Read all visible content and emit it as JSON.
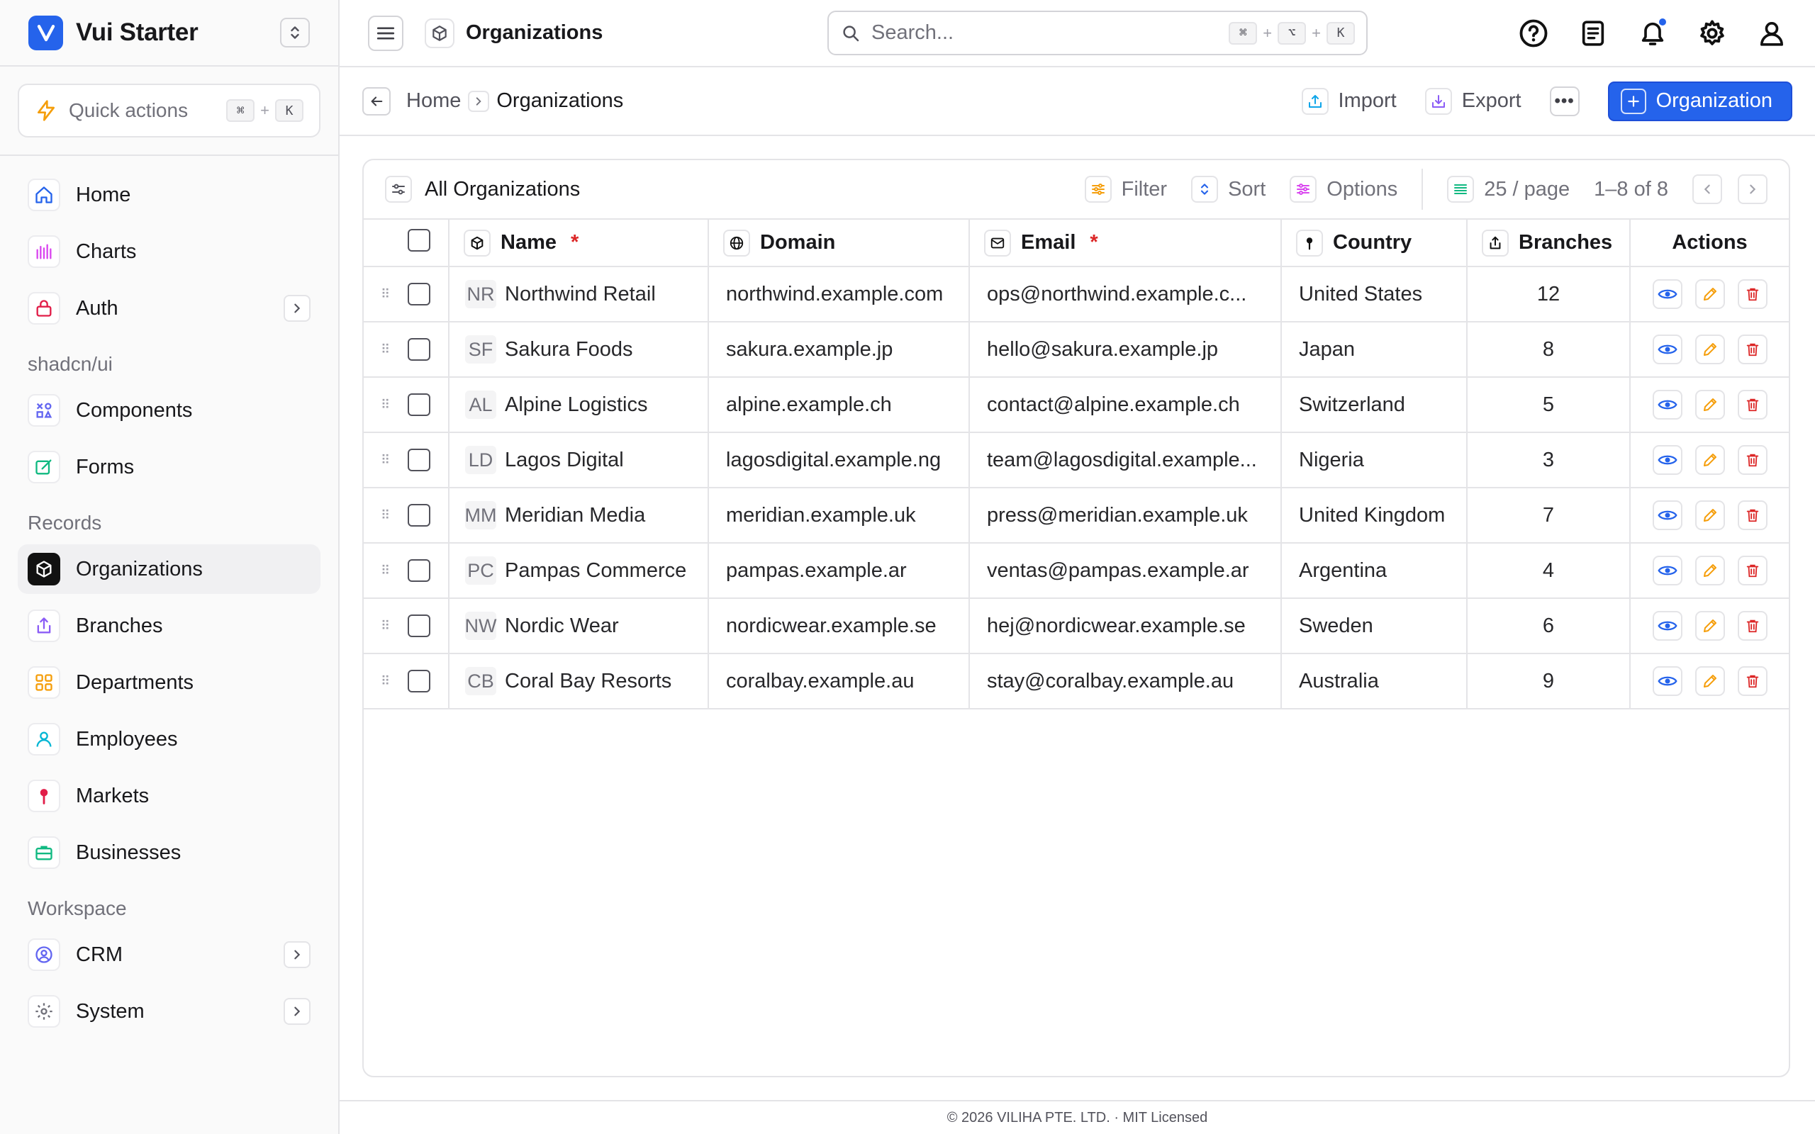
{
  "brand": {
    "name": "Vui Starter"
  },
  "quick_actions": {
    "label": "Quick actions",
    "kbd": [
      "⌘",
      "K"
    ],
    "plus": "+"
  },
  "sidebar": {
    "main_items": [
      {
        "label": "Home",
        "icon": "home-icon"
      },
      {
        "label": "Charts",
        "icon": "chart-icon"
      },
      {
        "label": "Auth",
        "icon": "lock-icon",
        "has_chevron": true
      }
    ],
    "sections": [
      {
        "title": "shadcn/ui",
        "items": [
          {
            "label": "Components"
          },
          {
            "label": "Forms"
          }
        ]
      },
      {
        "title": "Records",
        "items": [
          {
            "label": "Organizations",
            "active": true
          },
          {
            "label": "Branches"
          },
          {
            "label": "Departments"
          },
          {
            "label": "Employees"
          },
          {
            "label": "Markets"
          },
          {
            "label": "Businesses"
          }
        ]
      },
      {
        "title": "Workspace",
        "items": [
          {
            "label": "CRM"
          },
          {
            "label": "System"
          }
        ]
      }
    ]
  },
  "topbar": {
    "title": "Organizations",
    "search_placeholder": "Search...",
    "search_kbd": [
      "⌘",
      "⌥",
      "K"
    ],
    "plus": "+"
  },
  "breadcrumb": {
    "home": "Home",
    "current": "Organizations"
  },
  "page_actions": {
    "import": "Import",
    "export": "Export",
    "more": "•••",
    "primary": "Organization"
  },
  "toolbar": {
    "title": "All Organizations",
    "filter": "Filter",
    "sort": "Sort",
    "options": "Options",
    "per_page": "25 / page",
    "range": "1–8 of 8"
  },
  "table": {
    "columns": {
      "name": "Name",
      "domain": "Domain",
      "email": "Email",
      "country": "Country",
      "branches": "Branches",
      "actions": "Actions"
    },
    "required_mark": "*",
    "rows": [
      {
        "initials": "NR",
        "name": "Northwind Retail",
        "domain": "northwind.example.com",
        "email": "ops@northwind.example.c...",
        "country": "United States",
        "branches": "12"
      },
      {
        "initials": "SF",
        "name": "Sakura Foods",
        "domain": "sakura.example.jp",
        "email": "hello@sakura.example.jp",
        "country": "Japan",
        "branches": "8"
      },
      {
        "initials": "AL",
        "name": "Alpine Logistics",
        "domain": "alpine.example.ch",
        "email": "contact@alpine.example.ch",
        "country": "Switzerland",
        "branches": "5"
      },
      {
        "initials": "LD",
        "name": "Lagos Digital",
        "domain": "lagosdigital.example.ng",
        "email": "team@lagosdigital.example...",
        "country": "Nigeria",
        "branches": "3"
      },
      {
        "initials": "MM",
        "name": "Meridian Media",
        "domain": "meridian.example.uk",
        "email": "press@meridian.example.uk",
        "country": "United Kingdom",
        "branches": "7"
      },
      {
        "initials": "PC",
        "name": "Pampas Commerce",
        "domain": "pampas.example.ar",
        "email": "ventas@pampas.example.ar",
        "country": "Argentina",
        "branches": "4"
      },
      {
        "initials": "NW",
        "name": "Nordic Wear",
        "domain": "nordicwear.example.se",
        "email": "hej@nordicwear.example.se",
        "country": "Sweden",
        "branches": "6"
      },
      {
        "initials": "CB",
        "name": "Coral Bay Resorts",
        "domain": "coralbay.example.au",
        "email": "stay@coralbay.example.au",
        "country": "Australia",
        "branches": "9"
      }
    ]
  },
  "footer": {
    "text": "© 2026 VILIHA PTE. LTD. · MIT Licensed"
  },
  "colors": {
    "accent": "#2563eb",
    "danger": "#dc2626",
    "warning": "#f59e0b"
  }
}
